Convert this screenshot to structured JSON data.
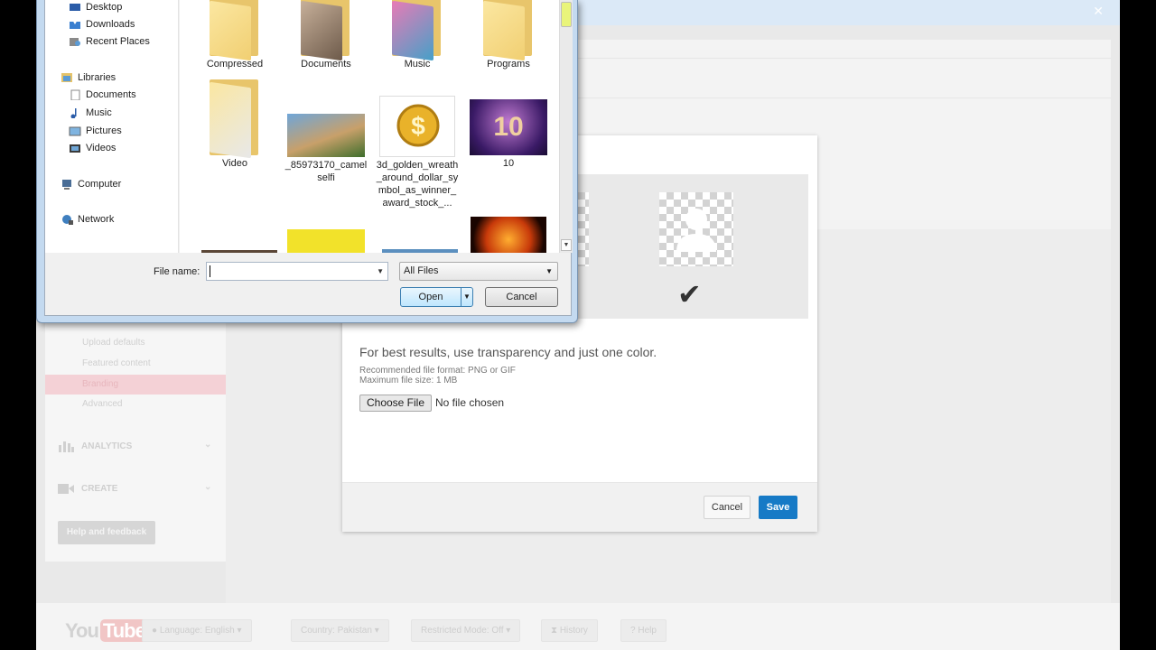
{
  "background_page": {
    "sidebar": {
      "items": [
        "Upload defaults",
        "Featured content",
        "Branding",
        "Advanced"
      ],
      "sections": [
        "ANALYTICS",
        "CREATE"
      ],
      "help_button": "Help and feedback"
    },
    "footer": {
      "logo_you": "You",
      "logo_tube": "Tube",
      "language": "Language: English",
      "country": "Country: Pakistan",
      "restricted": "Restricted Mode: Off",
      "history": "History",
      "help": "Help"
    }
  },
  "modal": {
    "heading": "For best results, use transparency and just one color.",
    "format": "Recommended file format: PNG or GIF",
    "size": "Maximum file size: 1 MB",
    "choose_file": "Choose File",
    "no_file": "No file chosen",
    "cancel": "Cancel",
    "save": "Save",
    "accent": "#167ac6"
  },
  "file_dialog": {
    "nav": {
      "desktop": "Desktop",
      "downloads": "Downloads",
      "recent": "Recent Places",
      "libraries": "Libraries",
      "documents": "Documents",
      "music": "Music",
      "pictures": "Pictures",
      "videos": "Videos",
      "computer": "Computer",
      "network": "Network"
    },
    "files": {
      "compressed": "Compressed",
      "documents": "Documents",
      "music": "Music",
      "programs": "Programs",
      "video": "Video",
      "camel": "_85973170_camelselfi",
      "golden": "3d_golden_wreath_around_dollar_symbol_as_winner_award_stock_...",
      "ten": "10"
    },
    "file_name_label": "File name:",
    "file_name_value": "",
    "filter": "All Files",
    "open": "Open",
    "cancel": "Cancel"
  }
}
